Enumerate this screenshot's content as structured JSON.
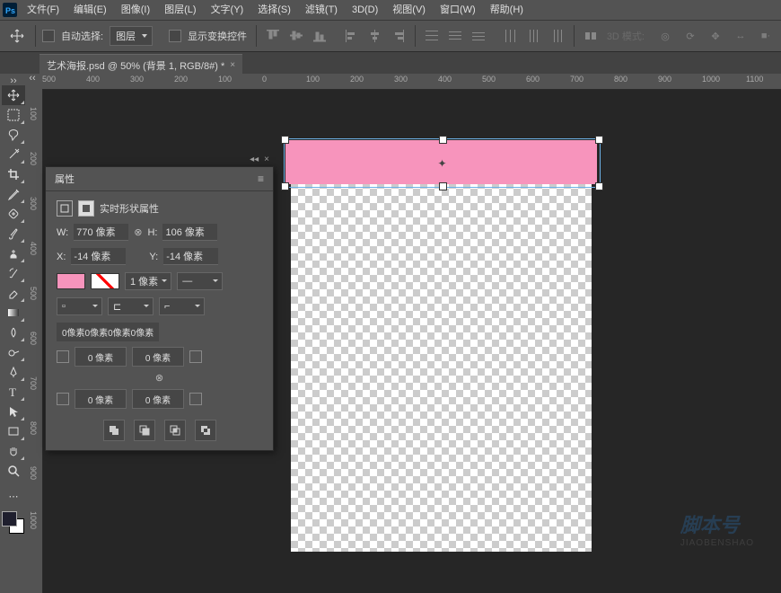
{
  "menu": {
    "file": "文件(F)",
    "edit": "编辑(E)",
    "image": "图像(I)",
    "layer": "图层(L)",
    "type": "文字(Y)",
    "select": "选择(S)",
    "filter": "滤镜(T)",
    "threeD": "3D(D)",
    "view": "视图(V)",
    "window": "窗口(W)",
    "help": "帮助(H)"
  },
  "options": {
    "autoSelect": "自动选择:",
    "target": "图层",
    "showControls": "显示变换控件",
    "mode3d": "3D 模式:"
  },
  "tab": {
    "title": "艺术海报.psd @ 50% (背景 1, RGB/8#) *"
  },
  "hruler": [
    "500",
    "400",
    "300",
    "200",
    "100",
    "0",
    "100",
    "200",
    "300",
    "400",
    "500",
    "600",
    "700",
    "800",
    "900",
    "1000",
    "1100"
  ],
  "vruler": [
    "100",
    "200",
    "300",
    "400",
    "500",
    "600",
    "700",
    "800",
    "900",
    "1000"
  ],
  "panel": {
    "title": "属性",
    "subtitle": "实时形状属性",
    "W": "W:",
    "Wval": "770 像素",
    "H": "H:",
    "Hval": "106 像素",
    "X": "X:",
    "Xval": "-14 像素",
    "Y": "Y:",
    "Yval": "-14 像素",
    "strokeW": "1 像素",
    "radiusHeader": "0像素0像素0像素0像素",
    "r1": "0 像素",
    "r2": "0 像素",
    "r3": "0 像素",
    "r4": "0 像素"
  },
  "colors": {
    "shape": "#f794bc",
    "fg": "#1f1f2e"
  },
  "watermark": {
    "top": "脚本号",
    "bot": "JIAOBENSHAO"
  }
}
